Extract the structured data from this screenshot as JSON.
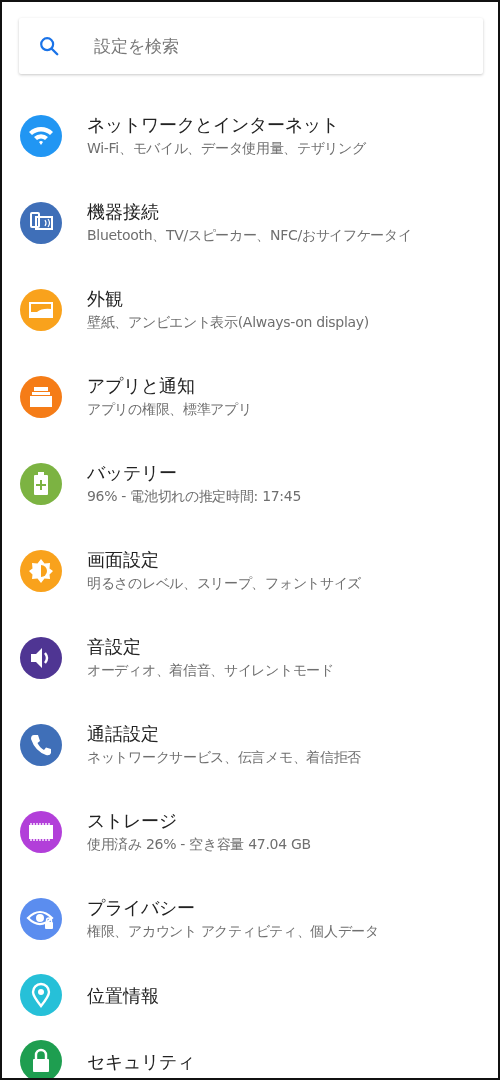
{
  "search": {
    "placeholder": "設定を検索"
  },
  "items": [
    {
      "title": "ネットワークとインターネット",
      "subtitle": "Wi-Fi、モバイル、データ使用量、テザリング",
      "color": "#2196f3"
    },
    {
      "title": "機器接続",
      "subtitle": "Bluetooth、TV/スピーカー、NFC/おサイフケータイ",
      "color": "#3f6fb8"
    },
    {
      "title": "外観",
      "subtitle": "壁紙、アンビエント表示(Always-on display)",
      "color": "#f9a21c"
    },
    {
      "title": "アプリと通知",
      "subtitle": "アプリの権限、標準アプリ",
      "color": "#f57c17"
    },
    {
      "title": "バッテリー",
      "subtitle": "96% - 電池切れの推定時間: 17:45",
      "color": "#7cb342"
    },
    {
      "title": "画面設定",
      "subtitle": "明るさのレベル、スリープ、フォントサイズ",
      "color": "#f9a21c"
    },
    {
      "title": "音設定",
      "subtitle": "オーディオ、着信音、サイレントモード",
      "color": "#4f3593"
    },
    {
      "title": "通話設定",
      "subtitle": "ネットワークサービス、伝言メモ、着信拒否",
      "color": "#3f6fb8"
    },
    {
      "title": "ストレージ",
      "subtitle": "使用済み 26% - 空き容量 47.04 GB",
      "color": "#b23fd9"
    },
    {
      "title": "プライバシー",
      "subtitle": "権限、アカウント アクティビティ、個人データ",
      "color": "#5b8def"
    },
    {
      "title": "位置情報",
      "color": "#26c0d8"
    },
    {
      "title": "セキュリティ",
      "color": "#1e9e50"
    }
  ]
}
